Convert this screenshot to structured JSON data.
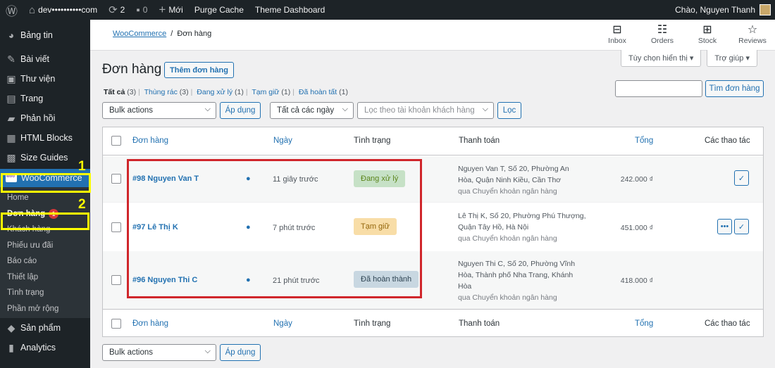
{
  "adminbar": {
    "site": "dev••••••••••com",
    "updates_count": "2",
    "comments_count": "0",
    "new_label": "Mới",
    "purge_cache": "Purge Cache",
    "theme_dashboard": "Theme Dashboard",
    "greeting": "Chào, Nguyen Thanh"
  },
  "sidebar": {
    "items": [
      {
        "label": "Bảng tin",
        "icon": "dashboard-icon"
      },
      {
        "label": "Bài viết",
        "icon": "pin-icon"
      },
      {
        "label": "Thư viện",
        "icon": "media-icon"
      },
      {
        "label": "Trang",
        "icon": "page-icon"
      },
      {
        "label": "Phản hồi",
        "icon": "comment-icon"
      },
      {
        "label": "HTML Blocks",
        "icon": "blocks-icon"
      },
      {
        "label": "Size Guides",
        "icon": "table-icon"
      }
    ],
    "woocommerce": "WooCommerce",
    "submenu": [
      {
        "label": "Home"
      },
      {
        "label": "Đơn hàng",
        "badge": "1"
      },
      {
        "label": "Khách hàng"
      },
      {
        "label": "Phiếu ưu đãi"
      },
      {
        "label": "Báo cáo"
      },
      {
        "label": "Thiết lập"
      },
      {
        "label": "Tình trạng"
      },
      {
        "label": "Phần mở rộng"
      }
    ],
    "after": [
      {
        "label": "Sản phẩm",
        "icon": "product-icon"
      },
      {
        "label": "Analytics",
        "icon": "chart-icon"
      }
    ],
    "annotations": {
      "one": "1",
      "two": "2"
    },
    "highlight_color": "#ffff00"
  },
  "header": {
    "breadcrumb_parent": "WooCommerce",
    "breadcrumb_sep": "/",
    "breadcrumb_current": "Đơn hàng",
    "icons": [
      {
        "label": "Inbox",
        "icon": "inbox-icon"
      },
      {
        "label": "Orders",
        "icon": "orders-icon"
      },
      {
        "label": "Stock",
        "icon": "stock-icon"
      },
      {
        "label": "Reviews",
        "icon": "star-icon"
      }
    ]
  },
  "screen_options": {
    "display": "Tùy chọn hiển thị ▾",
    "help": "Trợ giúp ▾"
  },
  "page": {
    "title": "Đơn hàng",
    "add_button": "Thêm đơn hàng",
    "filters": [
      {
        "label": "Tất cả",
        "count": "(3)",
        "current": true
      },
      {
        "label": "Thùng rác",
        "count": "(3)"
      },
      {
        "label": "Đang xử lý",
        "count": "(1)"
      },
      {
        "label": "Tạm giữ",
        "count": "(1)"
      },
      {
        "label": "Đã hoàn tất",
        "count": "(1)"
      }
    ],
    "search_button": "Tìm đơn hàng",
    "bulk_actions": "Bulk actions",
    "apply": "Áp dụng",
    "date_filter": "Tất cả các ngày",
    "customer_filter": "Lọc theo tài khoản khách hàng",
    "filter_button": "Lọc"
  },
  "table": {
    "headers": {
      "order": "Đơn hàng",
      "date": "Ngày",
      "status": "Tình trạng",
      "billing": "Thanh toán",
      "total": "Tổng",
      "actions": "Các thao tác"
    },
    "rows": [
      {
        "order": "#98 Nguyen Van T",
        "date": "11 giây trước",
        "status": "Đang xử lý",
        "status_bg": "#c6e1c6",
        "status_fg": "#5b841b",
        "address_lines": [
          "Nguyen Van T, Số 20, Phường An",
          "Hòa, Quận Ninh Kiều, Cần Thơ"
        ],
        "via": "qua Chuyển khoản ngân hàng",
        "total": "242.000 ₫"
      },
      {
        "order": "#97 Lê Thị K",
        "date": "7 phút trước",
        "status": "Tạm giữ",
        "status_bg": "#f8dda7",
        "status_fg": "#94660c",
        "address_lines": [
          "Lê Thị K, Số 20, Phường Phú Thượng,",
          "Quận Tây Hồ, Hà Nội"
        ],
        "via": "qua Chuyển khoản ngân hàng",
        "total": "451.000 ₫"
      },
      {
        "order": "#96 Nguyen Thi C",
        "date": "21 phút trước",
        "status": "Đã hoàn thành",
        "status_bg": "#c8d7e1",
        "status_fg": "#2e4453",
        "address_lines": [
          "Nguyen Thi C, Số 20, Phường Vĩnh",
          "Hòa, Thành phố Nha Trang, Khánh",
          "Hòa"
        ],
        "via": "qua Chuyển khoản ngân hàng",
        "total": "418.000 ₫"
      }
    ]
  },
  "annotation_box_color": "#d0262b"
}
